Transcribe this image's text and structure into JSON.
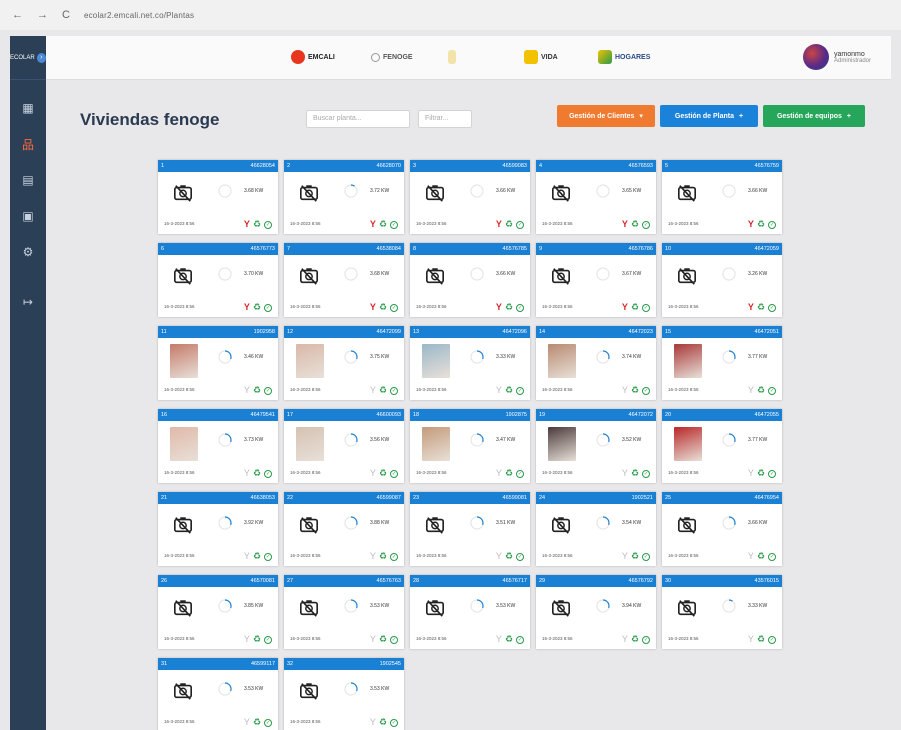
{
  "browser": {
    "back": "←",
    "forward": "→",
    "reload": "C",
    "url": "ecolar2.emcali.net.co/Plantas"
  },
  "sidebar": {
    "brand": "ECOLAR",
    "items": [
      {
        "icon": "grid-icon",
        "glyph": "▦",
        "active": false
      },
      {
        "icon": "network-icon",
        "glyph": "品",
        "active": true
      },
      {
        "icon": "dashboard-icon",
        "glyph": "▤",
        "active": false
      },
      {
        "icon": "building-icon",
        "glyph": "▣",
        "active": false
      },
      {
        "icon": "settings-icon",
        "glyph": "⚙",
        "active": false
      },
      {
        "icon": "logout-icon",
        "glyph": "↦",
        "active": false
      }
    ]
  },
  "topbar": {
    "logos": [
      "EMCALI",
      "FENOGE",
      "",
      "VIDA",
      "HOGARES"
    ],
    "user_name": "yamonmo",
    "user_role": "Administrador"
  },
  "page": {
    "title": "Viviendas fenoge",
    "search_placeholder": "Buscar planta...",
    "filter_placeholder": "Filtrar...",
    "btn_clients": "Gestión de Clientes",
    "btn_plants": "Gestión de Planta",
    "btn_teams": "Gestión de equipos"
  },
  "colors": {
    "header_blue": "#1a80d4",
    "sidebar": "#2b3f57",
    "orange": "#f07a2f",
    "green": "#26a65a"
  },
  "cards": [
    {
      "n": "1",
      "id": "46628054",
      "value": "3.68 KW",
      "date": "16-3-2023 8:56",
      "photo": "",
      "alert": true,
      "gauge": 0
    },
    {
      "n": "2",
      "id": "46628070",
      "value": "3.72 KW",
      "date": "16-3-2023 8:56",
      "photo": "",
      "alert": true,
      "gauge": 0.1
    },
    {
      "n": "3",
      "id": "46599083",
      "value": "3.66 KW",
      "date": "16-3-2023 8:56",
      "photo": "",
      "alert": true,
      "gauge": 0
    },
    {
      "n": "4",
      "id": "46576593",
      "value": "3.65 KW",
      "date": "16-3-2023 8:56",
      "photo": "",
      "alert": true,
      "gauge": 0
    },
    {
      "n": "5",
      "id": "46576759",
      "value": "3.66 KW",
      "date": "16-3-2023 8:56",
      "photo": "",
      "alert": true,
      "gauge": 0
    },
    {
      "n": "6",
      "id": "46576773",
      "value": "3.70 KW",
      "date": "16-3-2023 8:56",
      "photo": "",
      "alert": true,
      "gauge": 0
    },
    {
      "n": "7",
      "id": "46538084",
      "value": "3.68 KW",
      "date": "16-3-2023 8:56",
      "photo": "",
      "alert": true,
      "gauge": 0
    },
    {
      "n": "8",
      "id": "46576785",
      "value": "3.66 KW",
      "date": "16-3-2023 8:56",
      "photo": "",
      "alert": true,
      "gauge": 0
    },
    {
      "n": "9",
      "id": "46576786",
      "value": "3.67 KW",
      "date": "16-3-2023 8:56",
      "photo": "",
      "alert": true,
      "gauge": 0
    },
    {
      "n": "10",
      "id": "46472059",
      "value": "3.26 KW",
      "date": "16-3-2023 8:56",
      "photo": "",
      "alert": true,
      "gauge": 0
    },
    {
      "n": "11",
      "id": "1902958",
      "value": "3.46 KW",
      "date": "16-3-2023 8:56",
      "photo": "#c47a6a",
      "alert": false,
      "gauge": 0.3
    },
    {
      "n": "12",
      "id": "46472099",
      "value": "3.75 KW",
      "date": "16-3-2023 8:56",
      "photo": "#d9b8a8",
      "alert": false,
      "gauge": 0.3
    },
    {
      "n": "13",
      "id": "46472096",
      "value": "3.33 KW",
      "date": "16-3-2023 8:56",
      "photo": "#9ab8c8",
      "alert": false,
      "gauge": 0.3
    },
    {
      "n": "14",
      "id": "46472023",
      "value": "3.74 KW",
      "date": "16-3-2023 8:56",
      "photo": "#b88a70",
      "alert": false,
      "gauge": 0.3
    },
    {
      "n": "15",
      "id": "46472051",
      "value": "3.77 KW",
      "date": "16-3-2023 8:56",
      "photo": "#a83838",
      "alert": false,
      "gauge": 0.3
    },
    {
      "n": "16",
      "id": "46479541",
      "value": "3.73 KW",
      "date": "16-3-2023 8:56",
      "photo": "#e0b8a8",
      "alert": false,
      "gauge": 0.3
    },
    {
      "n": "17",
      "id": "46600093",
      "value": "3.56 KW",
      "date": "16-3-2023 8:56",
      "photo": "#d6c2b2",
      "alert": false,
      "gauge": 0.3
    },
    {
      "n": "18",
      "id": "1902875",
      "value": "3.47 KW",
      "date": "16-3-2023 8:56",
      "photo": "#c49a7a",
      "alert": false,
      "gauge": 0.3
    },
    {
      "n": "19",
      "id": "46472072",
      "value": "3.52 KW",
      "date": "16-3-2023 8:56",
      "photo": "#4a3a3a",
      "alert": false,
      "gauge": 0.3
    },
    {
      "n": "20",
      "id": "46472055",
      "value": "3.77 KW",
      "date": "16-3-2023 8:56",
      "photo": "#b82828",
      "alert": false,
      "gauge": 0.3
    },
    {
      "n": "21",
      "id": "46638053",
      "value": "3.92 KW",
      "date": "16-3-2023 8:56",
      "photo": "",
      "alert": false,
      "gauge": 0.3
    },
    {
      "n": "22",
      "id": "46599087",
      "value": "3.88 KW",
      "date": "16-3-2023 8:56",
      "photo": "",
      "alert": false,
      "gauge": 0.3
    },
    {
      "n": "23",
      "id": "46599081",
      "value": "3.51 KW",
      "date": "16-3-2023 8:56",
      "photo": "",
      "alert": false,
      "gauge": 0.3
    },
    {
      "n": "24",
      "id": "1902521",
      "value": "3.54 KW",
      "date": "16-3-2023 8:56",
      "photo": "",
      "alert": false,
      "gauge": 0.3
    },
    {
      "n": "25",
      "id": "46476954",
      "value": "3.66 KW",
      "date": "16-3-2023 8:56",
      "photo": "",
      "alert": false,
      "gauge": 0.3
    },
    {
      "n": "26",
      "id": "46570081",
      "value": "3.85 KW",
      "date": "16-3-2023 8:56",
      "photo": "",
      "alert": false,
      "gauge": 0.3
    },
    {
      "n": "27",
      "id": "46576763",
      "value": "3.53 KW",
      "date": "16-3-2023 8:56",
      "photo": "",
      "alert": false,
      "gauge": 0.3
    },
    {
      "n": "28",
      "id": "46576717",
      "value": "3.53 KW",
      "date": "16-3-2023 8:56",
      "photo": "",
      "alert": false,
      "gauge": 0.3
    },
    {
      "n": "29",
      "id": "46576792",
      "value": "3.94 KW",
      "date": "16-3-2023 8:56",
      "photo": "",
      "alert": false,
      "gauge": 0.3
    },
    {
      "n": "30",
      "id": "43576015",
      "value": "3.33 KW",
      "date": "16-3-2023 8:56",
      "photo": "",
      "alert": false,
      "gauge": 0.1
    },
    {
      "n": "31",
      "id": "46599117",
      "value": "3.53 KW",
      "date": "16-3-2023 8:56",
      "photo": "",
      "alert": false,
      "gauge": 0.3
    },
    {
      "n": "32",
      "id": "1902545",
      "value": "3.53 KW",
      "date": "16-3-2023 8:56",
      "photo": "",
      "alert": false,
      "gauge": 0.3
    }
  ]
}
